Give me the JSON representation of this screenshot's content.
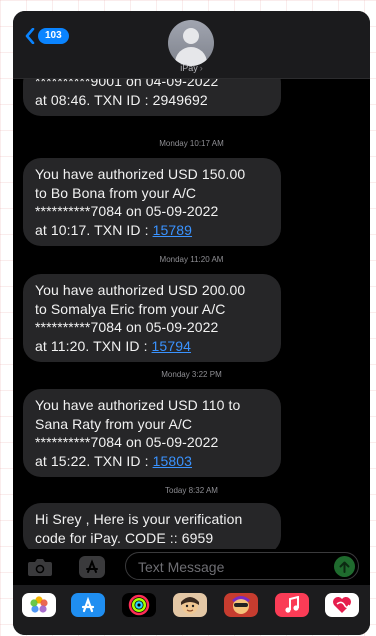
{
  "header": {
    "unread_count": "103",
    "contact_name": "iPay",
    "chevron": "›"
  },
  "messages": [
    {
      "kind": "bubble",
      "text": "**********9001 on 04-09-2022\nat 08:46. TXN ID : 2949692",
      "link": ""
    },
    {
      "kind": "timestamp",
      "text": "Monday 10:17 AM"
    },
    {
      "kind": "bubble",
      "text": "You have authorized USD 150.00\nto Bo Bona from your A/C\n**********7084 on 05-09-2022\nat 10:17. TXN ID : ",
      "link": "15789"
    },
    {
      "kind": "timestamp",
      "text": "Monday 11:20 AM"
    },
    {
      "kind": "bubble",
      "text": "You have authorized USD 200.00\nto Somalya Eric from your A/C\n**********7084 on 05-09-2022\nat 11:20. TXN ID : ",
      "link": "15794"
    },
    {
      "kind": "timestamp",
      "text": "Monday 3:22 PM"
    },
    {
      "kind": "bubble",
      "text": "You have authorized USD 110 to\nSana Raty from your A/C\n**********7084 on 05-09-2022\nat 15:22. TXN ID : ",
      "link": "15803"
    },
    {
      "kind": "timestamp",
      "text": "Today 8:32 AM"
    },
    {
      "kind": "bubble",
      "text": "Hi Srey , Here is your verification\ncode for iPay. CODE :: 6959",
      "link": ""
    }
  ],
  "input": {
    "placeholder": "Text Message"
  },
  "icons": {
    "back": "chevron-left-icon",
    "avatar": "person-icon",
    "camera": "camera-icon",
    "appstore": "app-store-icon",
    "send": "arrow-up-icon",
    "drawer": [
      "photos-icon",
      "app-store-icon",
      "activity-icon",
      "memoji-icon",
      "memoji-party-icon",
      "music-icon",
      "digital-touch-icon"
    ]
  },
  "colors": {
    "accent": "#0a84ff",
    "bubble": "#262628",
    "link": "#3a93ff",
    "send": "#1f6b2e"
  }
}
